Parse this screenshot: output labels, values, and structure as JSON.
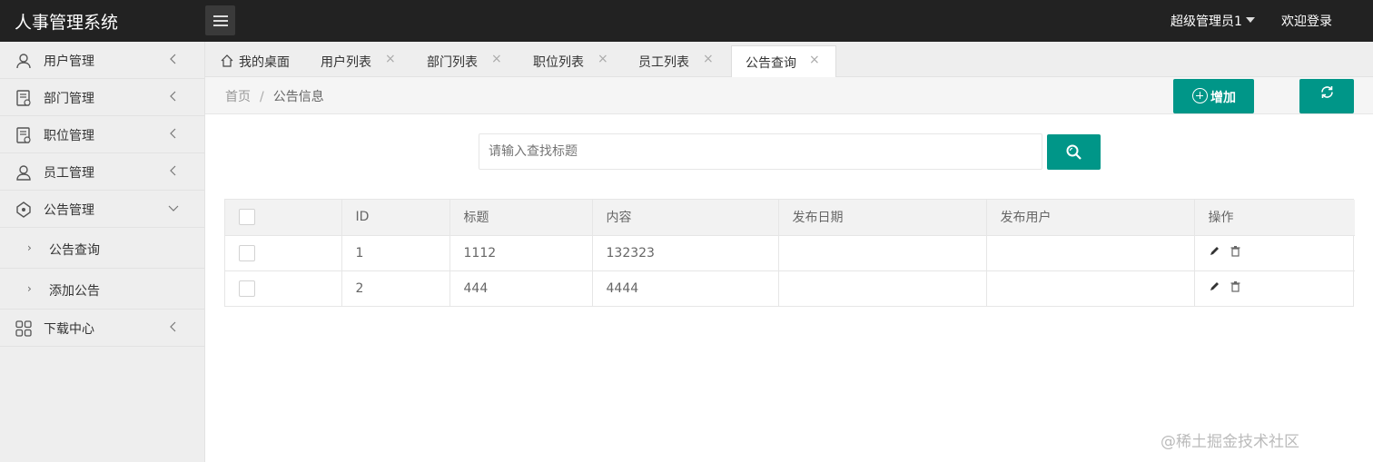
{
  "header": {
    "app_title": "人事管理系统",
    "user_name": "超级管理员1",
    "logout_label": "欢迎登录"
  },
  "sidebar": {
    "items": [
      {
        "label": "用户管理",
        "icon": "user-icon"
      },
      {
        "label": "部门管理",
        "icon": "department-icon"
      },
      {
        "label": "职位管理",
        "icon": "position-icon"
      },
      {
        "label": "员工管理",
        "icon": "employee-icon"
      },
      {
        "label": "公告管理",
        "icon": "notice-icon",
        "expanded": true
      },
      {
        "label": "下载中心",
        "icon": "grid-icon"
      }
    ],
    "subitems": [
      {
        "label": "公告查询"
      },
      {
        "label": "添加公告"
      }
    ]
  },
  "tabs": [
    {
      "label": "我的桌面",
      "icon": "home-icon"
    },
    {
      "label": "用户列表"
    },
    {
      "label": "部门列表"
    },
    {
      "label": "职位列表"
    },
    {
      "label": "员工列表"
    },
    {
      "label": "公告查询",
      "active": true
    }
  ],
  "breadcrumb": {
    "home": "首页",
    "separator": "/",
    "current": "公告信息"
  },
  "toolbar": {
    "add_label": "增加"
  },
  "search": {
    "placeholder": "请输入查找标题"
  },
  "table": {
    "columns": [
      "ID",
      "标题",
      "内容",
      "发布日期",
      "发布用户",
      "操作"
    ],
    "rows": [
      {
        "id": "1",
        "title": "1112",
        "content": "132323",
        "date": "",
        "user": ""
      },
      {
        "id": "2",
        "title": "444",
        "content": "4444",
        "date": "",
        "user": ""
      }
    ]
  },
  "watermark": "@稀土掘金技术社区",
  "colors": {
    "header_bg": "#222222",
    "accent": "#009688",
    "sidebar_bg": "#eeeeee"
  }
}
